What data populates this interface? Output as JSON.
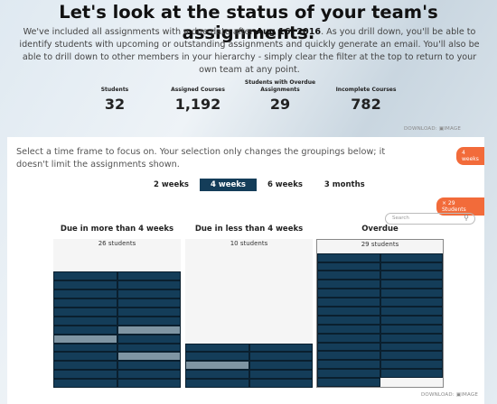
{
  "title": "Let's look at the status of your team's assignments.",
  "intro": {
    "before": "We've included all assignments with a due date after ",
    "date": "Aug 16, 2016",
    "after": ". As you drill down, you'll be able to identify students with upcoming or outstanding assignments and quickly generate an email. You'll also be able to drill down to other members in your hierarchy - simply clear the filter at the top to return to your own team at any point."
  },
  "stats": [
    {
      "label": "Students",
      "value": "32"
    },
    {
      "label": "Assigned Courses",
      "value": "1,192"
    },
    {
      "label": "Students with Overdue Assignments",
      "value": "29"
    },
    {
      "label": "Incomplete Courses",
      "value": "782"
    }
  ],
  "download": {
    "label": "DOWNLOAD:",
    "icon": "camera-icon",
    "image": "IMAGE"
  },
  "selection_text": "Select a time frame to focus on. Your selection only changes the groupings below; it doesn't limit the assignments shown.",
  "timeframe_badge": "4 weeks",
  "filter_badge": "× 29 Students",
  "tabs": [
    {
      "label": "2 weeks",
      "active": false
    },
    {
      "label": "4 weeks",
      "active": true
    },
    {
      "label": "6 weeks",
      "active": false
    },
    {
      "label": "3 months",
      "active": false
    }
  ],
  "search_placeholder": "Search",
  "colors": {
    "accent": "#f26b3a",
    "cell": "#143d59",
    "cell_highlight": "#7f95a3"
  },
  "panels": [
    {
      "title": "Due in more than 4 weeks",
      "count_label": "26 students",
      "students": 26,
      "highlighted": [
        13,
        14,
        19
      ]
    },
    {
      "title": "Due in less than 4 weeks",
      "count_label": "10 students",
      "students": 10,
      "highlighted": [
        4
      ]
    },
    {
      "title": "Overdue",
      "count_label": "29 students",
      "students": 29,
      "highlighted": [],
      "selected": true
    }
  ]
}
